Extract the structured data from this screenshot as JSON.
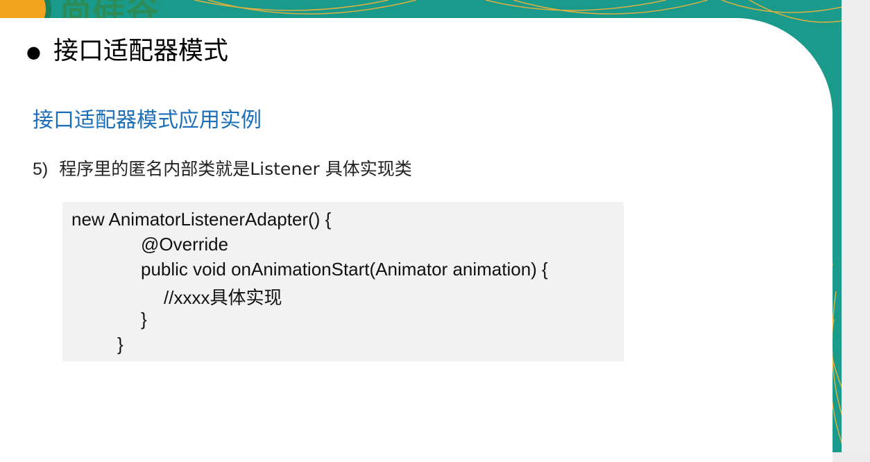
{
  "header": {
    "logo_text": "尚硅谷"
  },
  "slide": {
    "title": "接口适配器模式",
    "section_title": "接口适配器模式应用实例",
    "list_item": {
      "number": "5)",
      "text": "程序里的匿名内部类就是Listener 具体实现类"
    },
    "code_lines": [
      "new AnimatorListenerAdapter() {",
      "@Override",
      "public void onAnimationStart(Animator animation) {",
      "//xxxx具体实现",
      "}",
      "}"
    ]
  },
  "colors": {
    "section_title": "#1b6fb8",
    "code_background": "#f2f2f2",
    "accent_teal": "#1a9a8a",
    "accent_orange": "#f2a21c"
  }
}
